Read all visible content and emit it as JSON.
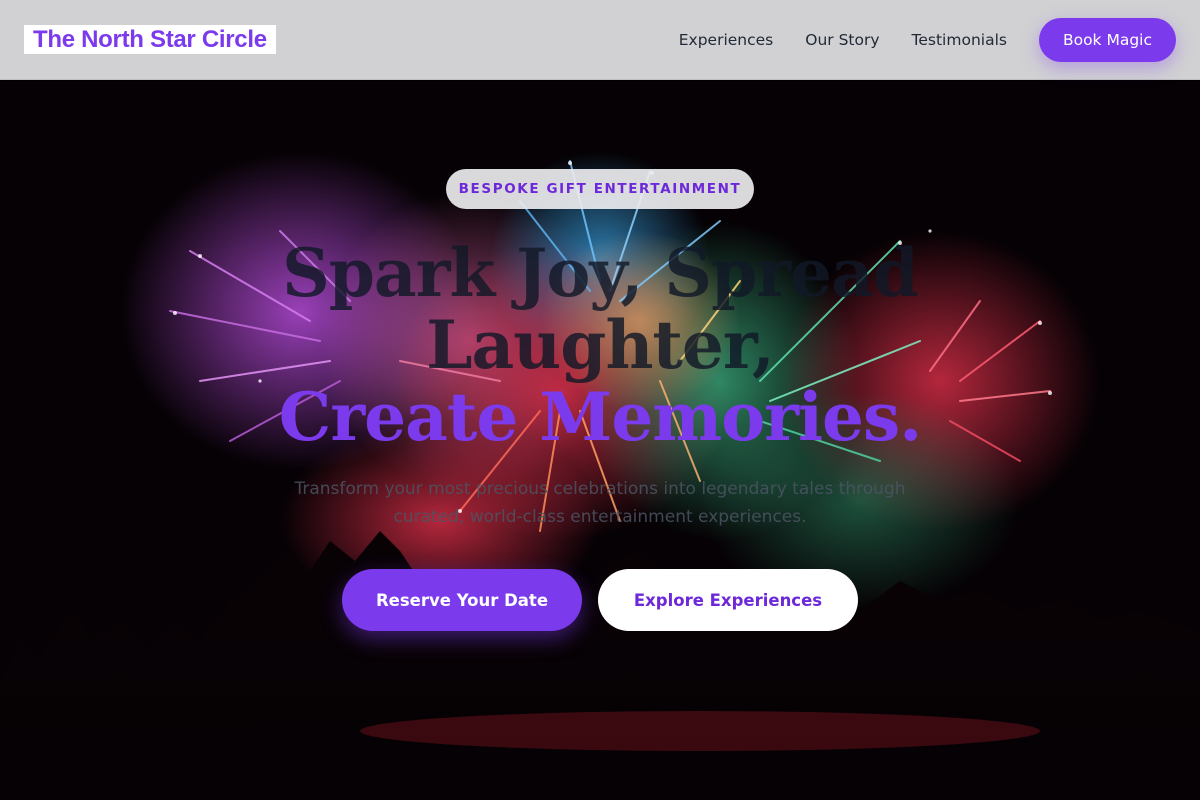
{
  "header": {
    "brand": "The North Star Circle",
    "nav": [
      {
        "label": "Experiences"
      },
      {
        "label": "Our Story"
      },
      {
        "label": "Testimonials"
      }
    ],
    "cta_label": "Book Magic"
  },
  "hero": {
    "badge": "BESPOKE GIFT ENTERTAINMENT",
    "headline_line1": "Spark Joy, Spread",
    "headline_line2": "Laughter,",
    "headline_line3": "Create Memories.",
    "subtitle": "Transform your most precious celebrations into legendary tales through curated, world-class entertainment experiences.",
    "primary_button": "Reserve Your Date",
    "secondary_button": "Explore Experiences",
    "background_image": "fireworks-crowd-silhouette"
  },
  "colors": {
    "accent": "#7c3aed",
    "header_bg": "#d1d1d3",
    "hero_bg": "#050104",
    "text_dark": "#111827"
  }
}
